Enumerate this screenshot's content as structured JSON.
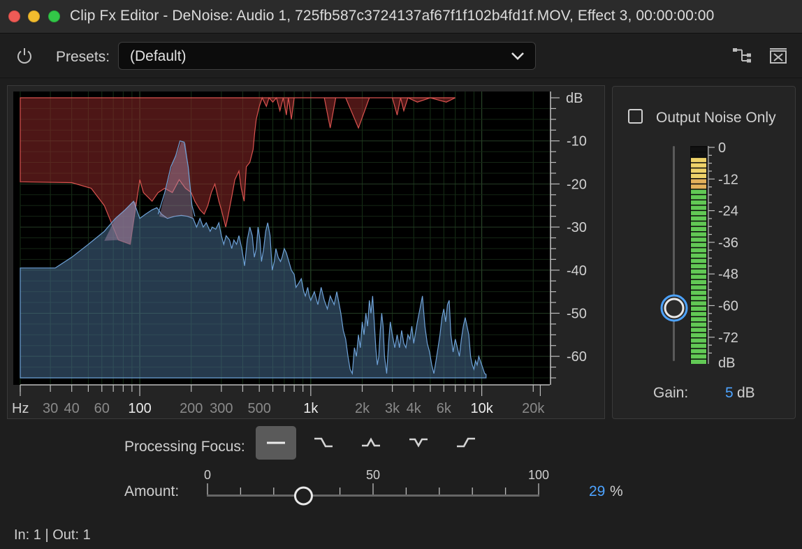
{
  "window": {
    "title": "Clip Fx Editor - DeNoise: Audio 1, 725fb587c3724137af67f1f102b4fd1f.MOV, Effect 3, 00:00:00:00"
  },
  "toolbar": {
    "presets_label": "Presets:",
    "preset_value": "(Default)"
  },
  "graph": {
    "db_unit": "dB",
    "db_ticks": [
      "-10",
      "-20",
      "-30",
      "-40",
      "-50",
      "-60"
    ],
    "hz_unit": "Hz",
    "freq_labels": [
      {
        "text": "30",
        "bright": false
      },
      {
        "text": "40",
        "bright": false
      },
      {
        "text": "60",
        "bright": false
      },
      {
        "text": "100",
        "bright": true
      },
      {
        "text": "200",
        "bright": false
      },
      {
        "text": "300",
        "bright": false
      },
      {
        "text": "500",
        "bright": false
      },
      {
        "text": "1k",
        "bright": true
      },
      {
        "text": "2k",
        "bright": false
      },
      {
        "text": "3k",
        "bright": false
      },
      {
        "text": "4k",
        "bright": false
      },
      {
        "text": "6k",
        "bright": false
      },
      {
        "text": "10k",
        "bright": true
      },
      {
        "text": "20k",
        "bright": false
      }
    ],
    "colors": {
      "noise": "#d9534f",
      "signal": "#5b8fc9"
    }
  },
  "output_noise": {
    "label": "Output Noise Only",
    "checked": false
  },
  "meter": {
    "scale": [
      "0",
      "-12",
      "-24",
      "-36",
      "-48",
      "-60",
      "-72"
    ],
    "unit": "dB",
    "gain_fader_level_db": 5
  },
  "gain": {
    "label": "Gain:",
    "value": "5",
    "unit": "dB"
  },
  "processing_focus": {
    "label": "Processing Focus:",
    "options": [
      "flat",
      "low-shelf",
      "peak",
      "notch",
      "high-shelf"
    ],
    "selected": "flat"
  },
  "amount": {
    "label": "Amount:",
    "scale_labels": [
      "0",
      "50",
      "100"
    ],
    "value": "29",
    "unit": "%",
    "value_fraction": 0.29
  },
  "status": {
    "io": "In: 1 | Out: 1"
  },
  "accent": "#4da3ff"
}
